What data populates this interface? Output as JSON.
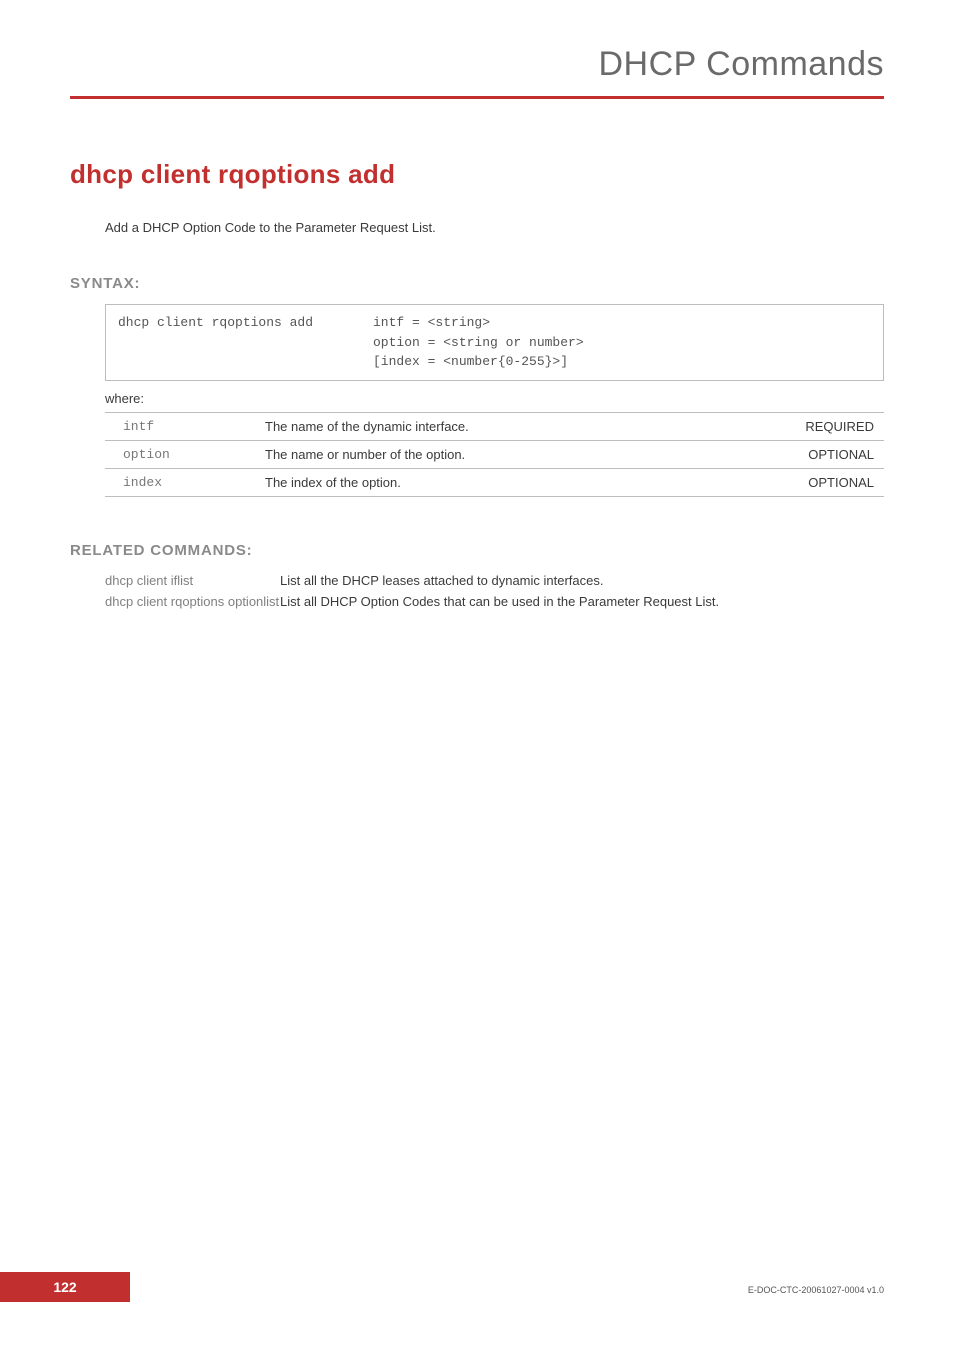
{
  "header": {
    "title": "DHCP Commands"
  },
  "command": {
    "title": "dhcp client rqoptions add",
    "description": "Add a DHCP Option Code to the Parameter Request List."
  },
  "syntax": {
    "heading": "SYNTAX:",
    "cmd": "dhcp client rqoptions add",
    "args": [
      "intf = <string>",
      "option = <string or number>",
      "[index = <number{0-255}>]"
    ],
    "where_label": "where:",
    "params": [
      {
        "name": "intf",
        "desc": "The name of the dynamic interface.",
        "req": "REQUIRED"
      },
      {
        "name": "option",
        "desc": "The name or number of the option.",
        "req": "OPTIONAL"
      },
      {
        "name": "index",
        "desc": "The index of the option.",
        "req": "OPTIONAL"
      }
    ]
  },
  "related": {
    "heading": "RELATED COMMANDS:",
    "items": [
      {
        "name": "dhcp client iflist",
        "desc": "List all the DHCP leases attached to dynamic interfaces."
      },
      {
        "name": "dhcp client rqoptions optionlist",
        "desc": "List all DHCP Option Codes that can be used in the Parameter Request List."
      }
    ]
  },
  "footer": {
    "page": "122",
    "docid": "E-DOC-CTC-20061027-0004 v1.0"
  }
}
